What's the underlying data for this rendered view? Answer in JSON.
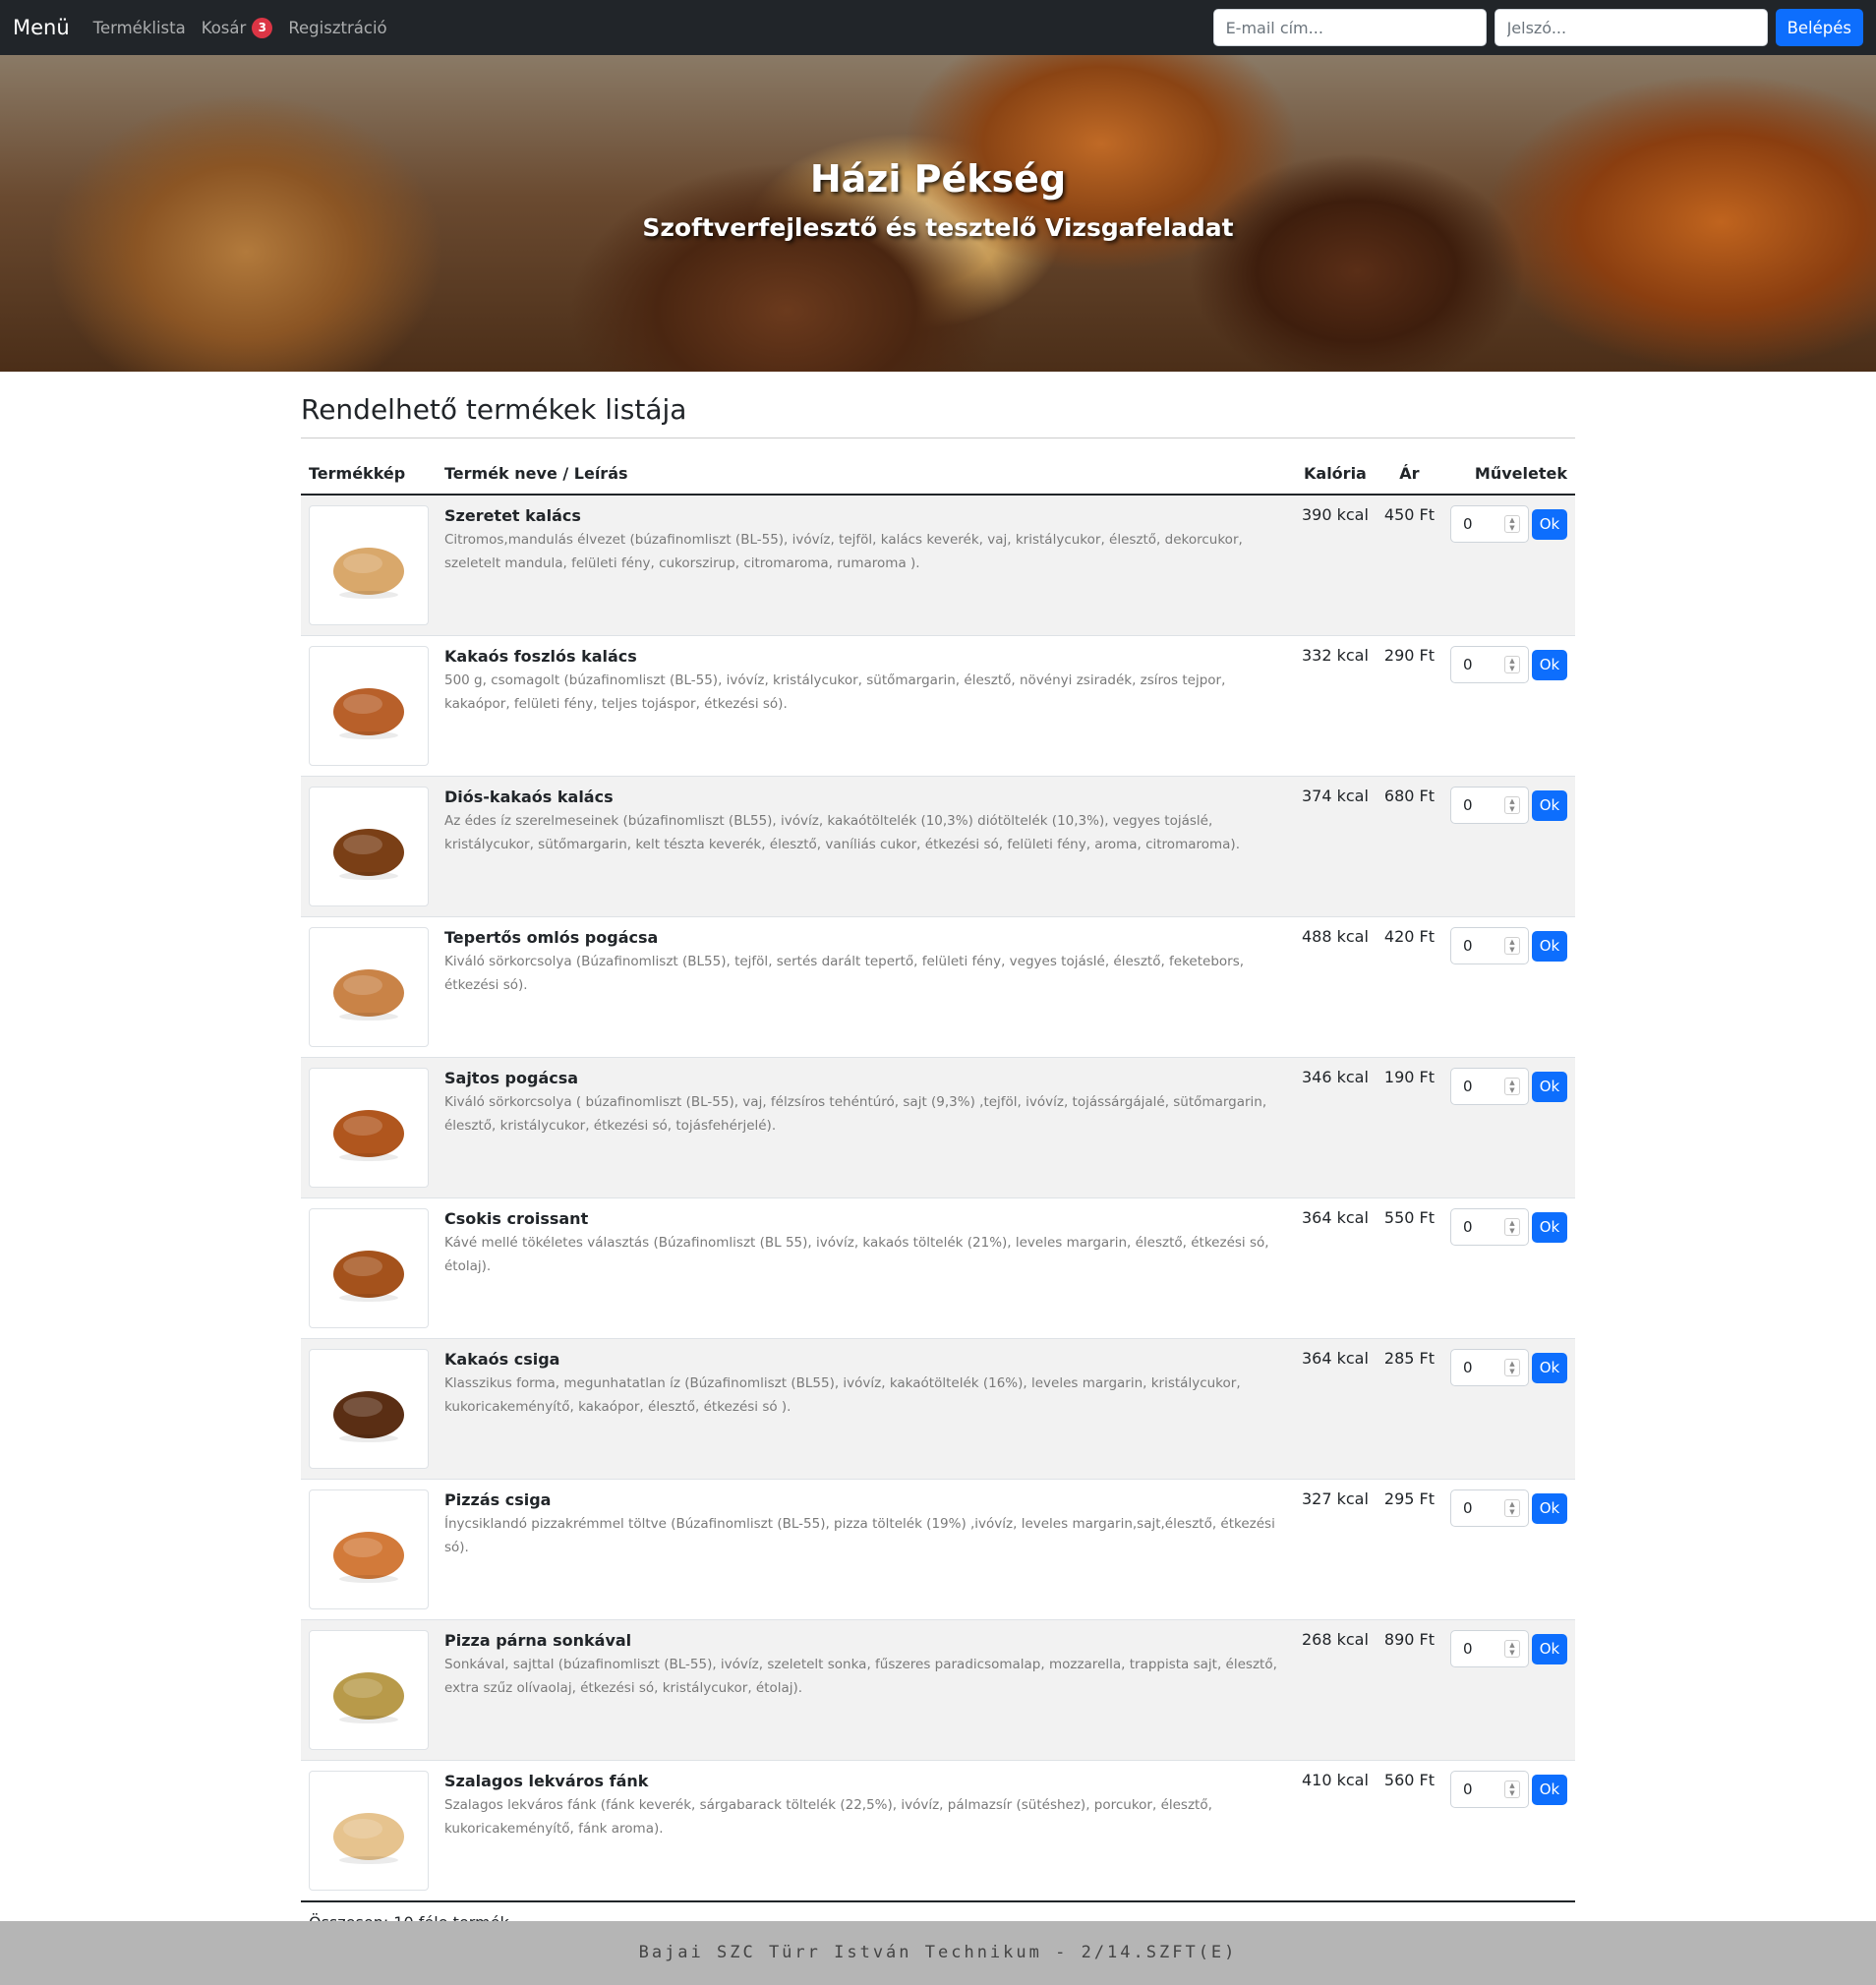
{
  "nav": {
    "brand": "Menü",
    "links": [
      {
        "label": "Terméklista"
      },
      {
        "label": "Kosár",
        "badge": "3"
      },
      {
        "label": "Regisztráció"
      }
    ],
    "email_placeholder": "E-mail cím...",
    "password_placeholder": "Jelszó...",
    "login_label": "Belépés"
  },
  "hero": {
    "title": "Házi Pékség",
    "subtitle": "Szoftverfejlesztő és tesztelő Vizsgafeladat"
  },
  "main": {
    "title": "Rendelhető termékek listája",
    "columns": [
      "Termékkép",
      "Termék neve / Leírás",
      "Kalória",
      "Ár",
      "Műveletek"
    ],
    "products": [
      {
        "name": "Szeretet kalács",
        "desc": "Citromos,mandulás élvezet (búzafinomliszt (BL-55), ivóvíz, tejföl, kalács keverék, vaj, kristálycukor, élesztő, dekorcukor, szeletelt mandula, felületi fény, cukorszirup, citromaroma, rumaroma ).",
        "cal": "390 kcal",
        "price": "450 Ft",
        "qty": "0",
        "image": "sweet-bread-image",
        "color": "#d9a86b"
      },
      {
        "name": "Kakaós foszlós kalács",
        "desc": "500 g, csomagolt (búzafinomliszt (BL-55), ivóvíz, kristálycukor, sütőmargarin, élesztő, növényi zsiradék, zsíros tejpor, kakaópor, felületi fény, teljes tojáspor, étkezési só).",
        "cal": "332 kcal",
        "price": "290 Ft",
        "qty": "0",
        "image": "braided-bread-image",
        "color": "#b8602a"
      },
      {
        "name": "Diós-kakaós kalács",
        "desc": "Az édes íz szerelmeseinek (búzafinomliszt (BL55), ivóvíz, kakaótöltelék (10,3%) diótöltelék (10,3%), vegyes tojáslé, kristálycukor, sütőmargarin, kelt tészta keverék, élesztő, vaníliás cukor, étkezési só, felületi fény, aroma, citromaroma).",
        "cal": "374 kcal",
        "price": "680 Ft",
        "qty": "0",
        "image": "walnut-cocoa-bread-image",
        "color": "#7a3f16"
      },
      {
        "name": "Tepertős omlós pogácsa",
        "desc": "Kiváló sörkorcsolya (Búzafinomliszt (BL55), tejföl, sertés darált tepertő, felületi fény, vegyes tojáslé, élesztő, feketebors, étkezési só).",
        "cal": "488 kcal",
        "price": "420 Ft",
        "qty": "0",
        "image": "scone-image",
        "color": "#c98347"
      },
      {
        "name": "Sajtos pogácsa",
        "desc": "Kiváló sörkorcsolya ( búzafinomliszt (BL-55), vaj, félzsíros tehéntúró, sajt (9,3%) ,tejföl, ivóvíz, tojássárgájalé, sütőmargarin, élesztő, kristálycukor, étkezési só, tojásfehérjelé).",
        "cal": "346 kcal",
        "price": "190 Ft",
        "qty": "0",
        "image": "cheese-scone-image",
        "color": "#b0561e"
      },
      {
        "name": "Csokis croissant",
        "desc": "Kávé mellé tökéletes választás (Búzafinomliszt (BL 55), ivóvíz, kakaós töltelék (21%), leveles margarin, élesztő, étkezési só, étolaj).",
        "cal": "364 kcal",
        "price": "550 Ft",
        "qty": "0",
        "image": "croissant-image",
        "color": "#a4521c"
      },
      {
        "name": "Kakaós csiga",
        "desc": "Klasszikus forma, megunhatatlan íz (Búzafinomliszt (BL55), ivóvíz, kakaótöltelék (16%), leveles margarin, kristálycukor, kukoricakeményítő, kakaópor, élesztő, étkezési só ).",
        "cal": "364 kcal",
        "price": "285 Ft",
        "qty": "0",
        "image": "cocoa-roll-image",
        "color": "#5a2e14"
      },
      {
        "name": "Pizzás csiga",
        "desc": "Ínycsiklandó pizzakrémmel töltve (Búzafinomliszt (BL-55), pizza töltelék (19%) ,ivóvíz, leveles margarin,sajt,élesztő, étkezési só).",
        "cal": "327 kcal",
        "price": "295 Ft",
        "qty": "0",
        "image": "pizza-roll-image",
        "color": "#d27a3a"
      },
      {
        "name": "Pizza párna sonkával",
        "desc": "Sonkával, sajttal (búzafinomliszt (BL-55), ivóvíz, szeletelt sonka, fűszeres paradicsomalap, mozzarella, trappista sajt, élesztő, extra szűz olívaolaj, étkezési só, kristálycukor, étolaj).",
        "cal": "268 kcal",
        "price": "890 Ft",
        "qty": "0",
        "image": "pizza-pillow-image",
        "color": "#b89a4a"
      },
      {
        "name": "Szalagos lekváros fánk",
        "desc": "Szalagos lekváros fánk (fánk keverék, sárgabarack töltelék (22,5%), ivóvíz, pálmazsír (sütéshez), porcukor, élesztő, kukoricakeményítő, fánk aroma).",
        "cal": "410 kcal",
        "price": "560 Ft",
        "qty": "0",
        "image": "donut-image",
        "color": "#e6c38e"
      }
    ],
    "ok_label": "Ok",
    "total": "Összesen: 10 féle termék"
  },
  "footer": {
    "text": "Bajai SZC Türr István Technikum - 2/14.SZFT(E)"
  }
}
